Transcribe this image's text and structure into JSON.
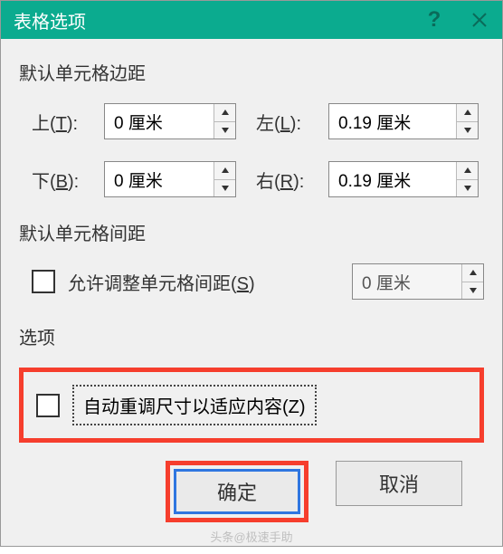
{
  "window": {
    "title": "表格选项",
    "help": "?",
    "close": "×"
  },
  "margins": {
    "label": "默认单元格边距",
    "top": {
      "label": "上(T):",
      "value": "0 厘米"
    },
    "bottom": {
      "label": "下(B):",
      "value": "0 厘米"
    },
    "left": {
      "label": "左(L):",
      "value": "0.19 厘米"
    },
    "right": {
      "label": "右(R):",
      "value": "0.19 厘米"
    }
  },
  "spacing": {
    "label": "默认单元格间距",
    "checkbox_label": "允许调整单元格间距(S)",
    "value": "0 厘米"
  },
  "options": {
    "label": "选项",
    "autofit_label": "自动重调尺寸以适应内容(Z)"
  },
  "buttons": {
    "ok": "确定",
    "cancel": "取消"
  },
  "watermark": "头条@极速手助"
}
